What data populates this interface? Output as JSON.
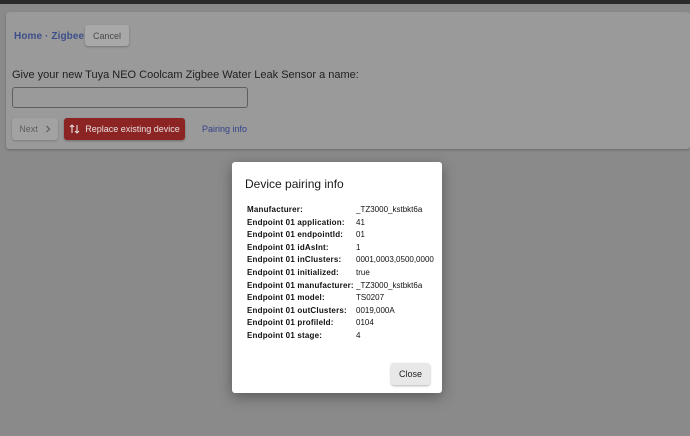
{
  "header": {
    "breadcrumb": "Home · Zigbee",
    "cancel_label": "Cancel"
  },
  "form": {
    "prompt": "Give your new Tuya NEO Coolcam Zigbee Water Leak Sensor a name:",
    "name_value": "",
    "next_label": "Next",
    "replace_label": "Replace existing device",
    "pairing_info_label": "Pairing info"
  },
  "dialog": {
    "title": "Device pairing info",
    "rows": [
      {
        "key": "Manufacturer:",
        "value": "_TZ3000_kstbkt6a"
      },
      {
        "key": "Endpoint 01 application:",
        "value": "41"
      },
      {
        "key": "Endpoint 01 endpointId:",
        "value": "01"
      },
      {
        "key": "Endpoint 01 idAsInt:",
        "value": "1"
      },
      {
        "key": "Endpoint 01 inClusters:",
        "value": "0001,0003,0500,0000"
      },
      {
        "key": "Endpoint 01 initialized:",
        "value": "true"
      },
      {
        "key": "Endpoint 01 manufacturer:",
        "value": "_TZ3000_kstbkt6a"
      },
      {
        "key": "Endpoint 01 model:",
        "value": "TS0207"
      },
      {
        "key": "Endpoint 01 outClusters:",
        "value": "0019,000A"
      },
      {
        "key": "Endpoint 01 profileId:",
        "value": "0104"
      },
      {
        "key": "Endpoint 01 stage:",
        "value": "4"
      }
    ],
    "close_label": "Close"
  },
  "icons": {
    "next": "chevron-right-icon",
    "replace": "swap-vertical-icon"
  }
}
